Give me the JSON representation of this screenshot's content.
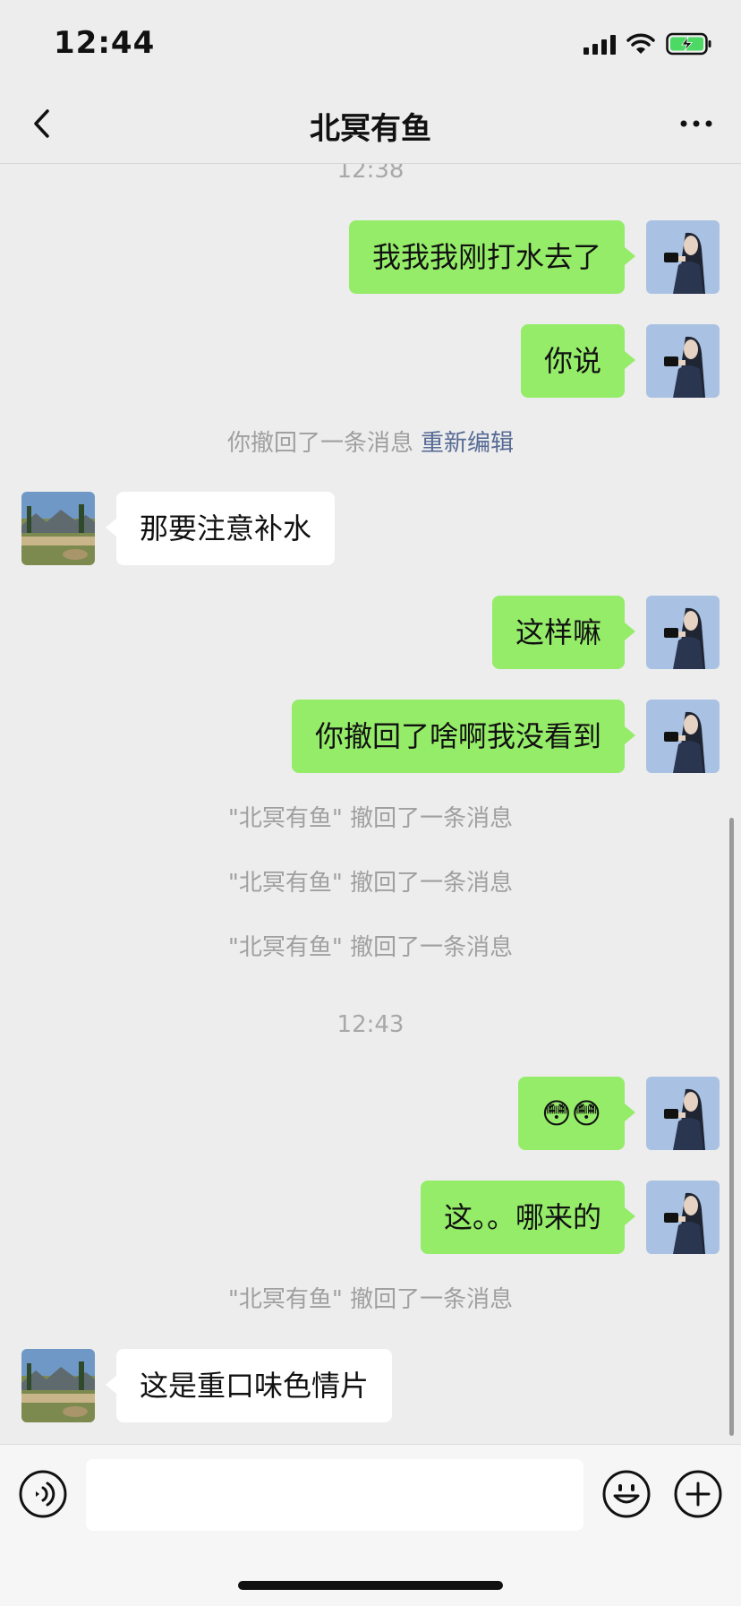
{
  "status": {
    "time": "12:44",
    "battery_state": "charging",
    "battery_color": "#4cd964"
  },
  "nav": {
    "title": "北冥有鱼"
  },
  "chat": {
    "timestamp_1": "12:38",
    "msg_1": "我我我刚打水去了",
    "msg_2": "你说",
    "recall_self": "你撤回了一条消息",
    "re_edit": "重新编辑",
    "msg_3": "那要注意补水",
    "msg_4": "这样嘛",
    "msg_5": "你撤回了啥啊我没看到",
    "recall_peer_1": "\"北冥有鱼\" 撤回了一条消息",
    "recall_peer_2": "\"北冥有鱼\" 撤回了一条消息",
    "recall_peer_3": "\"北冥有鱼\" 撤回了一条消息",
    "timestamp_2": "12:43",
    "msg_6": "😳😳",
    "msg_7": "这。。哪来的",
    "recall_peer_4": "\"北冥有鱼\" 撤回了一条消息",
    "msg_8": "这是重口味色情片"
  },
  "colors": {
    "outgoing_bubble": "#95ec69",
    "incoming_bubble": "#ffffff",
    "background": "#ededed",
    "link": "#576b95"
  },
  "input": {
    "value": "",
    "placeholder": ""
  },
  "icons": {
    "back": "chevron-left-icon",
    "more": "more-horizontal-icon",
    "voice": "voice-icon",
    "emoji": "emoji-icon",
    "plus": "plus-icon"
  }
}
